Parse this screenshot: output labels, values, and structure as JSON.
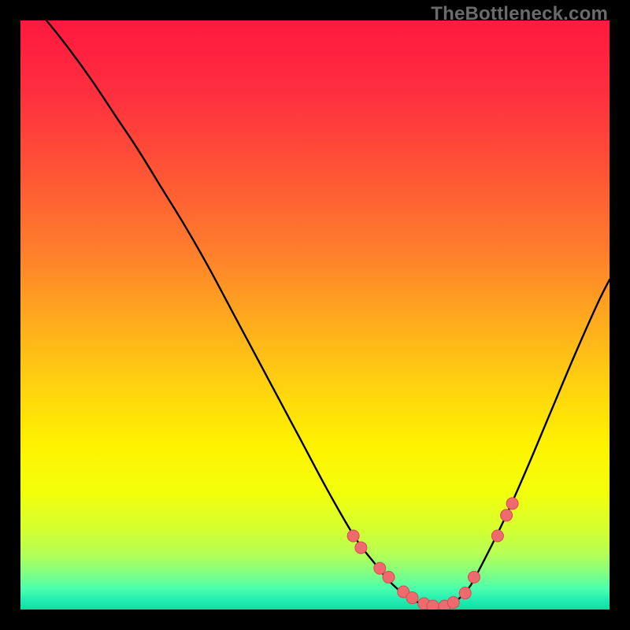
{
  "watermark": "TheBottleneck.com",
  "colors": {
    "background": "#000000",
    "curve": "#000000",
    "dot_fill": "#ef6a6e",
    "dot_stroke": "#d44c50",
    "gradient_stops": [
      {
        "offset": 0.0,
        "color": "#ff193f"
      },
      {
        "offset": 0.12,
        "color": "#ff2e3f"
      },
      {
        "offset": 0.25,
        "color": "#ff5236"
      },
      {
        "offset": 0.38,
        "color": "#ff7a2d"
      },
      {
        "offset": 0.5,
        "color": "#ffa71f"
      },
      {
        "offset": 0.62,
        "color": "#ffd20f"
      },
      {
        "offset": 0.72,
        "color": "#fff200"
      },
      {
        "offset": 0.8,
        "color": "#f3ff0a"
      },
      {
        "offset": 0.86,
        "color": "#d7ff2e"
      },
      {
        "offset": 0.905,
        "color": "#b6ff55"
      },
      {
        "offset": 0.94,
        "color": "#7dff86"
      },
      {
        "offset": 0.965,
        "color": "#4affae"
      },
      {
        "offset": 0.985,
        "color": "#20ebb0"
      },
      {
        "offset": 1.0,
        "color": "#14db9f"
      }
    ]
  },
  "chart_data": {
    "type": "line",
    "title": "",
    "xlabel": "",
    "ylabel": "",
    "xlim": [
      0,
      100
    ],
    "ylim": [
      0,
      100
    ],
    "series": [
      {
        "name": "bottleneck-curve",
        "x": [
          0,
          4,
          8,
          12,
          16,
          20,
          24,
          28,
          32,
          36,
          40,
          44,
          48,
          52,
          56,
          58,
          60,
          62,
          64,
          66,
          68,
          70,
          72,
          74,
          76,
          78,
          82,
          86,
          90,
          94,
          98,
          100
        ],
        "y": [
          105,
          100.5,
          95.5,
          90,
          84,
          78,
          71.5,
          65,
          58,
          50.5,
          43,
          35.5,
          28,
          20.5,
          13.5,
          10.5,
          8,
          5.5,
          3.5,
          2,
          1,
          0.5,
          0.5,
          1.5,
          3.5,
          7,
          15,
          24,
          33.5,
          43,
          52,
          56
        ]
      }
    ],
    "dots": {
      "name": "bottleneck-markers",
      "x": [
        56.5,
        57.8,
        61.0,
        62.5,
        65.0,
        66.5,
        68.5,
        70.0,
        72.0,
        73.5,
        75.5,
        77.0,
        81.0,
        82.5,
        83.5
      ],
      "y": [
        12.5,
        10.5,
        7.0,
        5.5,
        3.0,
        2.0,
        1.0,
        0.6,
        0.6,
        1.2,
        2.8,
        5.5,
        12.5,
        16.0,
        18.0
      ]
    }
  }
}
